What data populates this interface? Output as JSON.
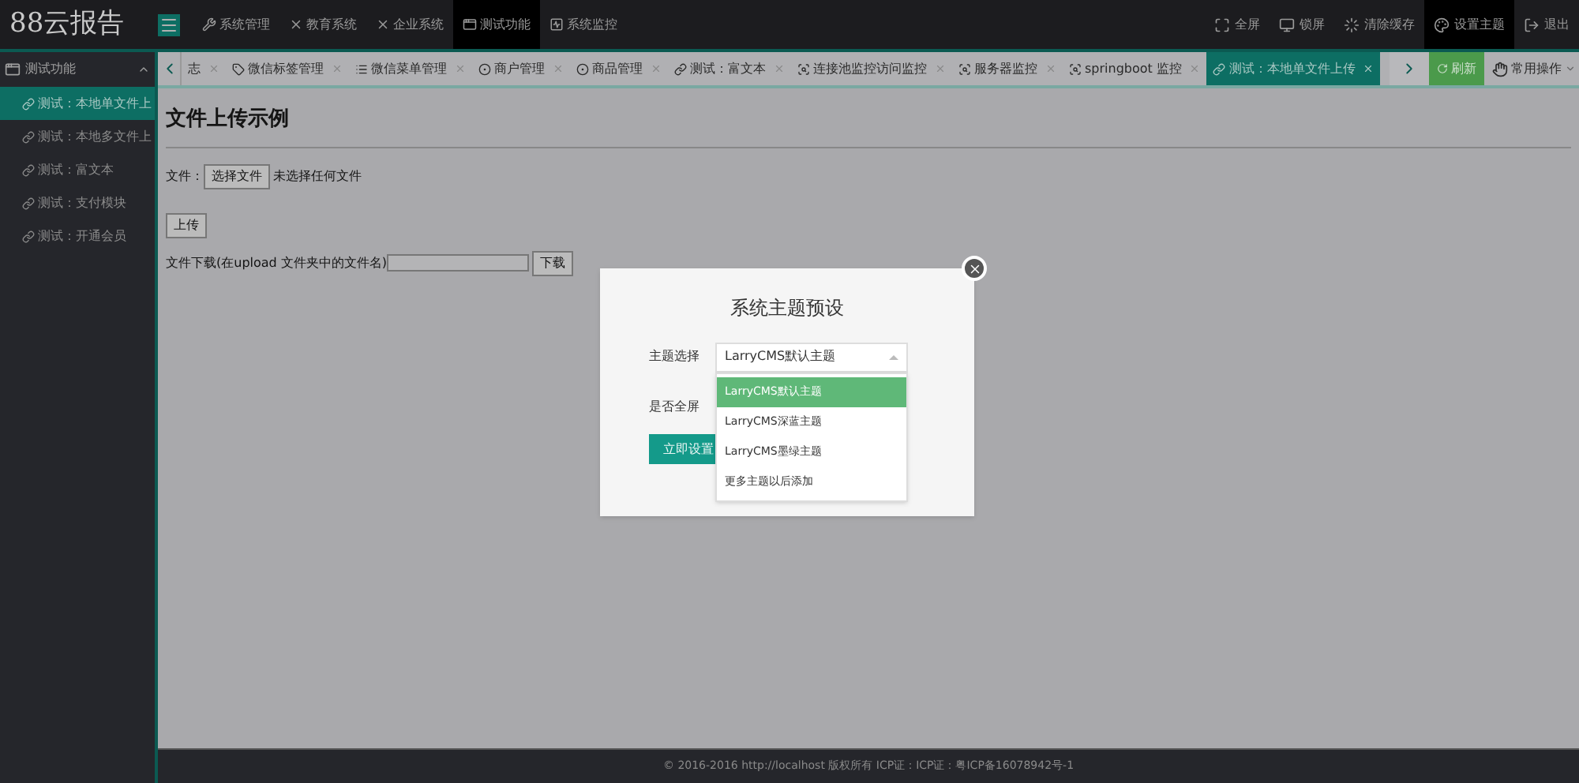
{
  "header": {
    "logo": "88云报告",
    "menu": [
      {
        "label": "系统管理",
        "selected": false
      },
      {
        "label": "教育系统",
        "selected": false
      },
      {
        "label": "企业系统",
        "selected": false
      },
      {
        "label": "测试功能",
        "selected": true
      },
      {
        "label": "系统监控",
        "selected": false
      }
    ],
    "actions": [
      {
        "label": "全屏",
        "selected": false
      },
      {
        "label": "锁屏",
        "selected": false
      },
      {
        "label": "清除缓存",
        "selected": false
      },
      {
        "label": "设置主题",
        "selected": true
      },
      {
        "label": "退出",
        "selected": false
      }
    ]
  },
  "sidebar": {
    "title": "测试功能",
    "expanded": true,
    "items": [
      {
        "label": "测试：本地单文件上",
        "selected": true
      },
      {
        "label": "测试：本地多文件上",
        "selected": false
      },
      {
        "label": "测试：富文本",
        "selected": false
      },
      {
        "label": "测试：支付模块",
        "selected": false
      },
      {
        "label": "测试：开通会员",
        "selected": false
      }
    ]
  },
  "tabs": [
    {
      "label": "志",
      "selected": false
    },
    {
      "label": "微信标签管理",
      "selected": false
    },
    {
      "label": "微信菜单管理",
      "selected": false
    },
    {
      "label": "商户管理",
      "selected": false
    },
    {
      "label": "商品管理",
      "selected": false
    },
    {
      "label": "测试：富文本",
      "selected": false
    },
    {
      "label": "连接池监控访问监控",
      "selected": false
    },
    {
      "label": "服务器监控",
      "selected": false
    },
    {
      "label": "springboot 监控",
      "selected": false
    },
    {
      "label": "测试：本地单文件上传",
      "selected": true
    }
  ],
  "tab_tools": {
    "refresh": "刷新",
    "operations": "常用操作"
  },
  "content": {
    "title": "文件上传示例",
    "file_label": "文件：",
    "choose_button": "选择文件",
    "file_status": "未选择任何文件",
    "upload_button": "上传",
    "download_label": "文件下载(在upload 文件夹中的文件名)",
    "download_button": "下载"
  },
  "modal": {
    "title": "系统主题预设",
    "theme_label": "主题选择",
    "theme_value": "LarryCMS默认主题",
    "expanded": true,
    "options": [
      {
        "label": "LarryCMS默认主题",
        "selected": true
      },
      {
        "label": "LarryCMS深蓝主题",
        "selected": false
      },
      {
        "label": "LarryCMS墨绿主题",
        "selected": false
      },
      {
        "label": "更多主题以后添加",
        "selected": false
      }
    ],
    "fullscreen_label": "是否全屏",
    "apply_button": "立即设置"
  },
  "status_bar": "© 2016-2016 http://localhost 版权所有 ICP证：ICP证：粤ICP备16078942号-1"
}
